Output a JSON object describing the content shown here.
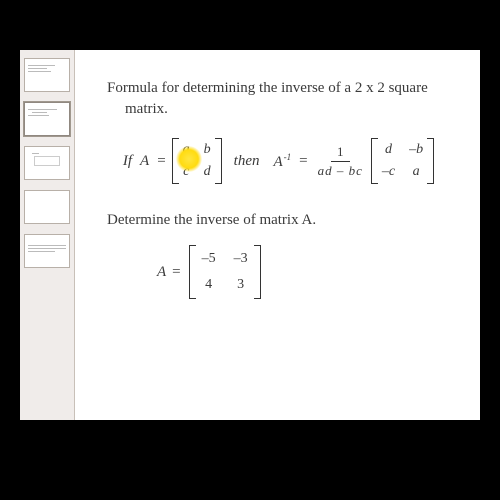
{
  "title": {
    "line1": "Formula for determining the inverse of a 2 x 2 square",
    "line2": "matrix."
  },
  "formula": {
    "if": "If",
    "A": "A",
    "eq": "=",
    "m1": {
      "a": "a",
      "b": "b",
      "c": "c",
      "d": "d"
    },
    "then": "then",
    "Ai": "A",
    "sup": "-1",
    "frac_num": "1",
    "frac_den": "ad – bc",
    "m2": {
      "a": "d",
      "b": "–b",
      "c": "–c",
      "d": "a"
    }
  },
  "section2": "Determine the inverse of matrix A.",
  "example": {
    "A": "A",
    "eq": "=",
    "m": {
      "a": "–5",
      "b": "–3",
      "c": "4",
      "d": "3"
    }
  }
}
